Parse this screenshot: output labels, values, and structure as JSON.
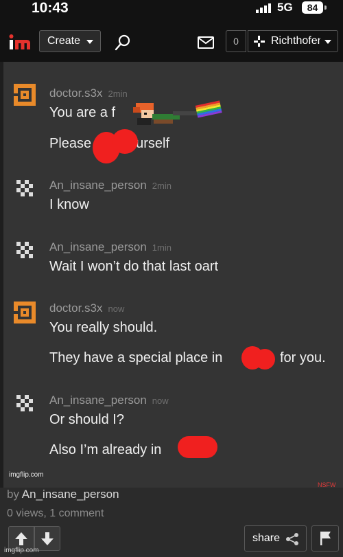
{
  "status_bar": {
    "time": "10:43",
    "network": "5G",
    "battery": "84"
  },
  "header": {
    "logo_text": "im",
    "create_label": "Create",
    "notification_count": "0",
    "username": "Richthofen",
    "colors": {
      "logo_i": "#ffffff",
      "logo_m": "#e5322d"
    }
  },
  "meme": {
    "comments": [
      {
        "author": "doctor.s3x",
        "time": "2min",
        "lines": [
          "You are a f",
          "Please",
          "ourself"
        ],
        "avatar": "orange-square-icon"
      },
      {
        "author": "An_insane_person",
        "time": "2min",
        "lines": [
          "I know"
        ],
        "avatar": "checker-avatar-icon"
      },
      {
        "author": "An_insane_person",
        "time": "1min",
        "lines": [
          "Wait I won’t do that last oart"
        ],
        "avatar": "checker-avatar-icon"
      },
      {
        "author": "doctor.s3x",
        "time": "now",
        "lines": [
          "You really should.",
          "They have a special place in",
          "for you."
        ],
        "avatar": "orange-square-icon"
      },
      {
        "author": "An_insane_person",
        "time": "now",
        "lines": [
          "Or should I?",
          "Also I’m already in"
        ],
        "avatar": "checker-avatar-icon"
      }
    ],
    "watermark": "imgflip.com",
    "tag": "NSFW",
    "censor_color": "#f0201f"
  },
  "post": {
    "by_prefix": "by",
    "author": "An_insane_person",
    "stats": "0 views, 1 comment",
    "share_label": "share",
    "bottom_watermark": "imgflip.com"
  }
}
